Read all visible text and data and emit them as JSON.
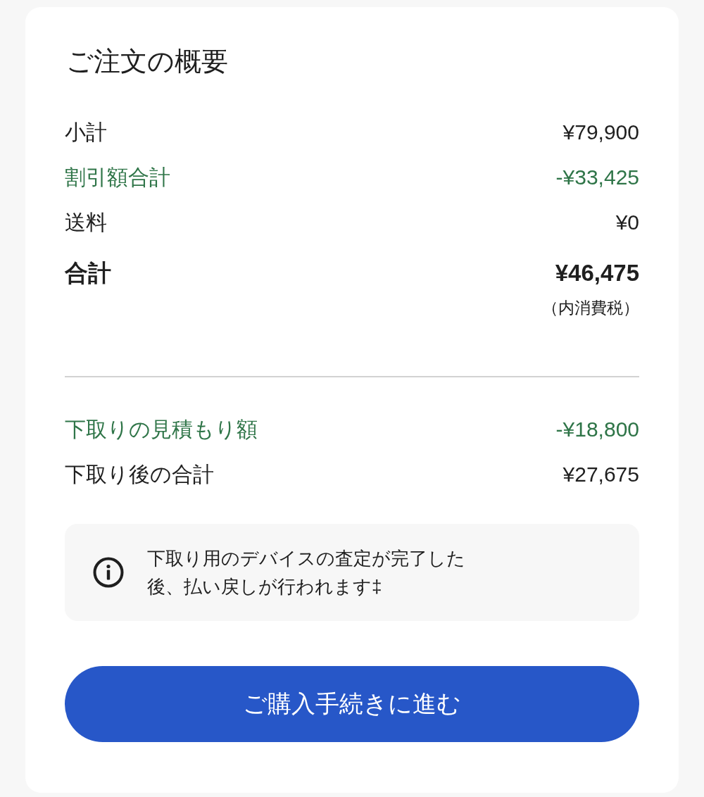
{
  "title": "ご注文の概要",
  "summary": [
    {
      "label": "小計",
      "value": "¥79,900",
      "kind": "plain"
    },
    {
      "label": "割引額合計",
      "value": "-¥33,425",
      "kind": "discount"
    },
    {
      "label": "送料",
      "value": "¥0",
      "kind": "plain"
    },
    {
      "label": "合計",
      "value": "¥46,475",
      "kind": "total",
      "note": "（内消費税）"
    }
  ],
  "trade_in": [
    {
      "label": "下取りの見積もり額",
      "value": "-¥18,800",
      "kind": "discount"
    },
    {
      "label": "下取り後の合計",
      "value": "¥27,675",
      "kind": "plain"
    }
  ],
  "info": {
    "text": "下取り用のデバイスの査定が完了した後、払い戻しが行われます‡"
  },
  "button": {
    "label": "ご購入手続きに進む"
  }
}
